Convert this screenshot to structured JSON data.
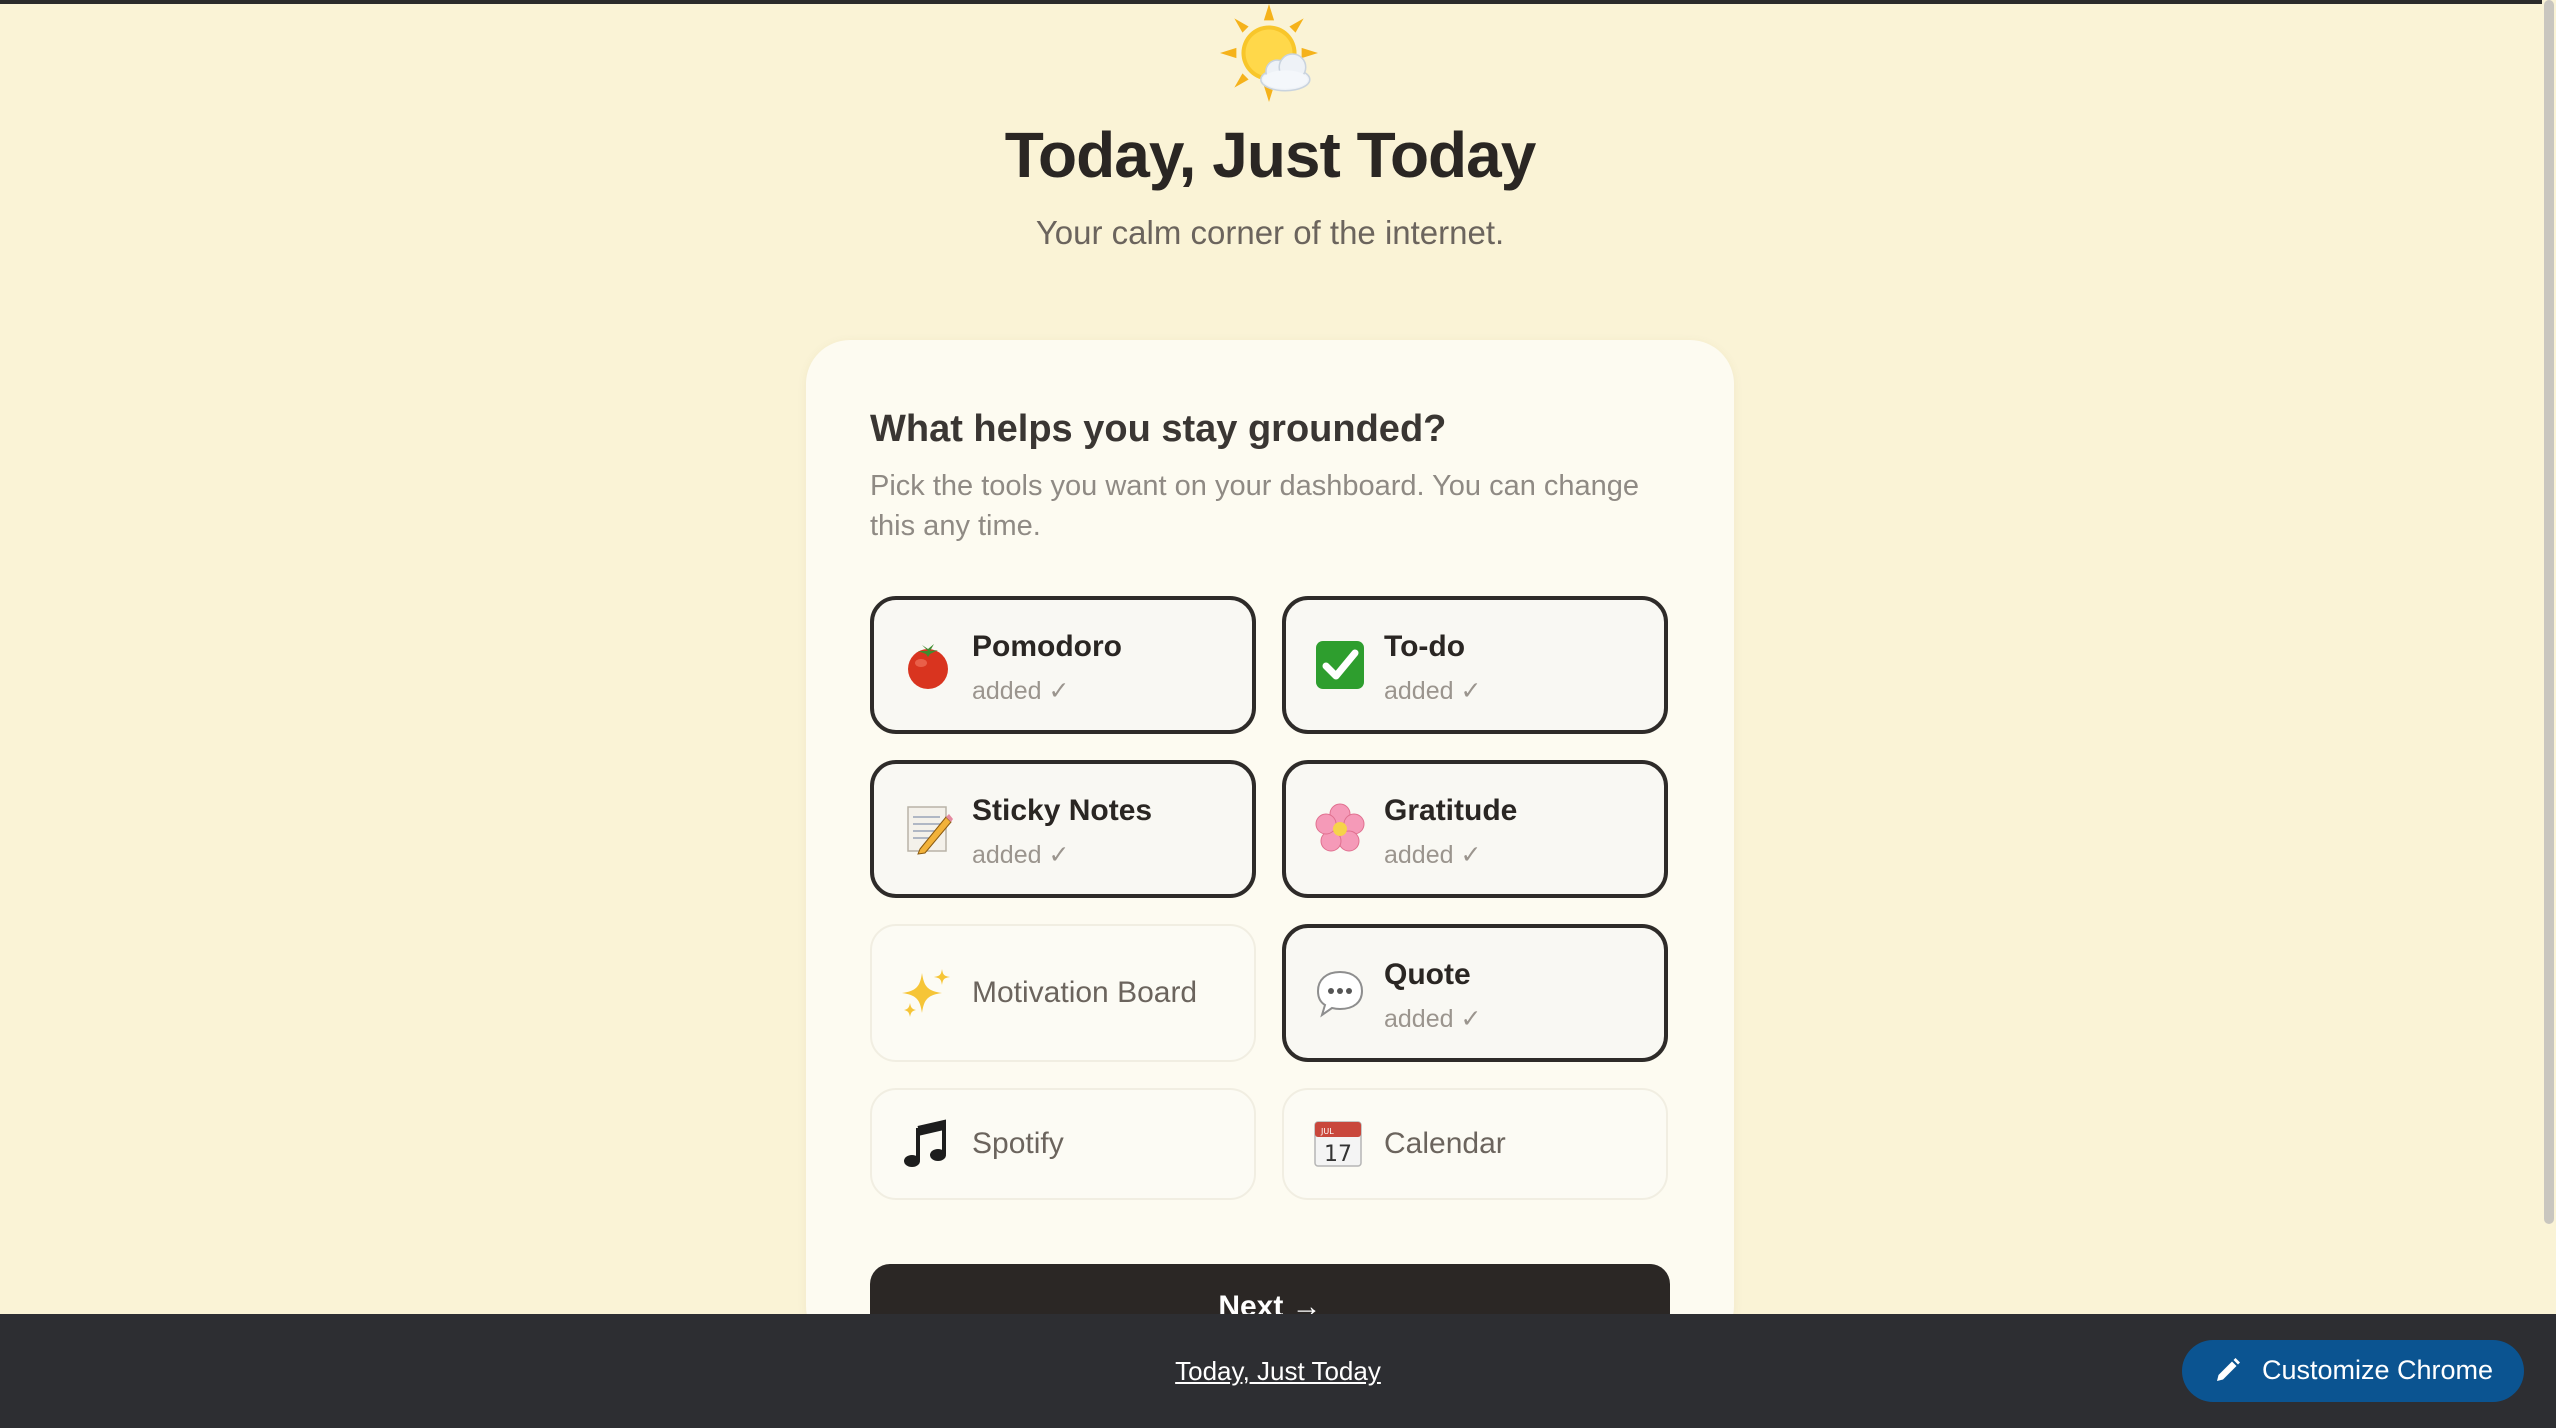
{
  "hero": {
    "icon": "sun-behind-cloud-icon",
    "title": "Today, Just Today",
    "subtitle": "Your calm corner of the internet."
  },
  "card": {
    "title": "What helps you stay grounded?",
    "description": "Pick the tools you want on your dashboard. You can change this any time.",
    "tools": [
      {
        "name": "Pomodoro",
        "status": "added ✓",
        "selected": true,
        "icon": "tomato-icon"
      },
      {
        "name": "To-do",
        "status": "added ✓",
        "selected": true,
        "icon": "check-mark-icon"
      },
      {
        "name": "Sticky Notes",
        "status": "added ✓",
        "selected": true,
        "icon": "memo-icon"
      },
      {
        "name": "Gratitude",
        "status": "added ✓",
        "selected": true,
        "icon": "blossom-icon"
      },
      {
        "name": "Motivation Board",
        "status": "",
        "selected": false,
        "icon": "sparkles-icon"
      },
      {
        "name": "Quote",
        "status": "added ✓",
        "selected": true,
        "icon": "speech-bubble-icon"
      },
      {
        "name": "Spotify",
        "status": "",
        "selected": false,
        "icon": "music-notes-icon"
      },
      {
        "name": "Calendar",
        "status": "",
        "selected": false,
        "icon": "calendar-icon"
      }
    ],
    "calendar_day": "17",
    "calendar_month": "JUL",
    "next_label": "Next →"
  },
  "footer": {
    "link_label": "Today, Just Today",
    "customize_label": "Customize Chrome"
  },
  "colors": {
    "page_bg": "#faf3d6",
    "card_bg": "#fdfbf1",
    "selected_border": "#2e2b29",
    "next_button_bg": "#2b2725",
    "bottom_bar_bg": "#2d2e32",
    "customize_bg": "#0b5491"
  }
}
